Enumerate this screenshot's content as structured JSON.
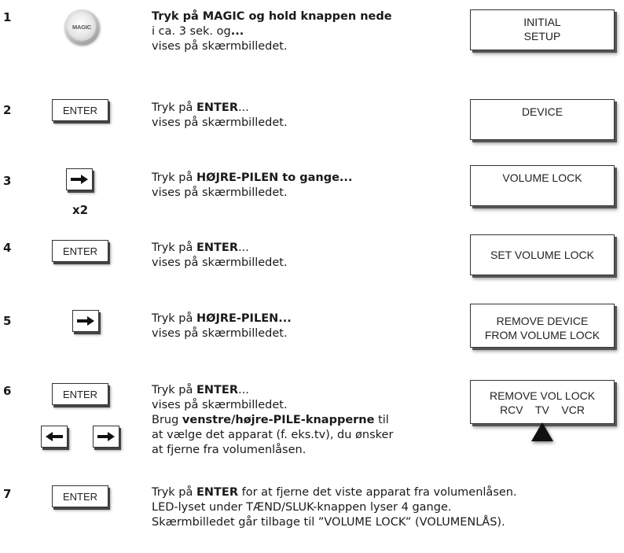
{
  "steps": [
    {
      "num": "1",
      "lines": [
        {
          "bold": "Tryk på MAGIC og hold knappen nede",
          "rest": ""
        },
        {
          "pre": "i ca. 3 sek. og",
          "bold": "...",
          "rest": ""
        },
        {
          "pre": "vises på skærmbilledet.",
          "bold": "",
          "rest": ""
        }
      ],
      "screen": [
        "INITIAL",
        "SETUP"
      ]
    },
    {
      "num": "2",
      "key": "ENTER",
      "lines": [
        {
          "pre": "Tryk på ",
          "bold": "ENTER",
          "rest": "..."
        },
        {
          "pre": "vises på skærmbilledet.",
          "bold": "",
          "rest": ""
        }
      ],
      "screen": [
        "DEVICE"
      ]
    },
    {
      "num": "3",
      "key_icon": "right-arrow-icon",
      "multiplier": "x2",
      "lines": [
        {
          "pre": "Tryk på ",
          "bold": "HØJRE-PILEN to gange...",
          "rest": ""
        },
        {
          "pre": "vises på skærmbilledet.",
          "bold": "",
          "rest": ""
        }
      ],
      "screen": [
        "VOLUME LOCK"
      ]
    },
    {
      "num": "4",
      "key": "ENTER",
      "lines": [
        {
          "pre": "Tryk på ",
          "bold": "ENTER",
          "rest": "..."
        },
        {
          "pre": "vises på skærmbilledet.",
          "bold": "",
          "rest": ""
        }
      ],
      "screen": [
        "SET VOLUME LOCK"
      ]
    },
    {
      "num": "5",
      "key_icon": "right-arrow-icon",
      "lines": [
        {
          "pre": "Tryk på ",
          "bold": "HØJRE-PILEN...",
          "rest": ""
        },
        {
          "pre": "vises på skærmbilledet.",
          "bold": "",
          "rest": ""
        }
      ],
      "screen": [
        "REMOVE DEVICE",
        "FROM VOLUME LOCK"
      ]
    },
    {
      "num": "6",
      "key": "ENTER",
      "key_icons": [
        "left-arrow-icon",
        "right-arrow-icon"
      ],
      "lines": [
        {
          "pre": "Tryk på ",
          "bold": "ENTER",
          "rest": "..."
        },
        {
          "pre": "vises på skærmbilledet.",
          "bold": "",
          "rest": ""
        },
        {
          "pre": "Brug ",
          "bold": "venstre/højre-PILE-knapperne",
          "rest": " til"
        },
        {
          "pre": "at vælge det apparat (f. eks.tv), du ønsker",
          "bold": "",
          "rest": ""
        },
        {
          "pre": "at fjerne fra volumenlåsen.",
          "bold": "",
          "rest": ""
        }
      ],
      "screen": [
        "REMOVE VOL LOCK",
        "RCV    TV    VCR"
      ]
    },
    {
      "num": "7",
      "key": "ENTER",
      "lines": [
        {
          "pre": "Tryk på ",
          "bold": "ENTER",
          "rest": " for at fjerne det viste apparat fra volumenlåsen."
        },
        {
          "pre": "LED-lyset under TÆND/SLUK-knappen lyser 4 gange.",
          "bold": "",
          "rest": ""
        },
        {
          "pre": "Skærmbilledet går tilbage til ”VOLUME LOCK” (VOLUMENLÅS).",
          "bold": "",
          "rest": ""
        }
      ]
    }
  ],
  "magic_button_label": "MAGIC"
}
